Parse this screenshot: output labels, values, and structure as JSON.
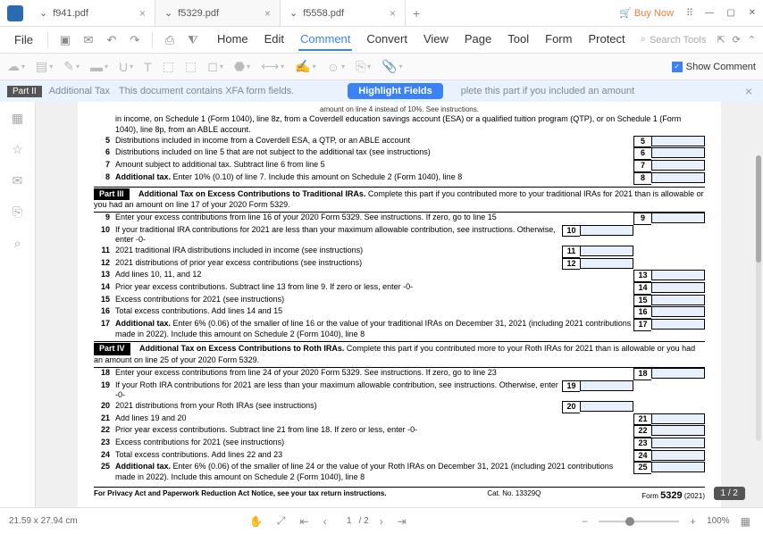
{
  "titlebar": {
    "tabs": [
      {
        "name": "f941.pdf",
        "active": false
      },
      {
        "name": "f5329.pdf",
        "active": true
      },
      {
        "name": "f5558.pdf",
        "active": false
      }
    ],
    "buynow": "Buy Now"
  },
  "menubar": {
    "file": "File",
    "nav": {
      "home": "Home",
      "edit": "Edit",
      "comment": "Comment",
      "convert": "Convert",
      "view": "View",
      "page": "Page",
      "tool": "Tool",
      "form": "Form",
      "protect": "Protect"
    },
    "search_placeholder": "Search Tools"
  },
  "toolbar": {
    "showcomment": "Show Comment"
  },
  "notice": {
    "part": "Part II",
    "title_fragment": "Additional Tax",
    "msg": "This document contains XFA form fields.",
    "button": "Highlight Fields",
    "tail": "plete this part if you included an amount"
  },
  "doc": {
    "pre_text": "amount on line 4 instead of 10%. See instructions.",
    "line_a": "in income, on Schedule 1 (Form 1040), line 8z, from a Coverdell education savings account (ESA) or a qualified tuition program (QTP), or on Schedule 1 (Form 1040), line 8p, from an ABLE account.",
    "rows_a": [
      {
        "n": "5",
        "t": "Distributions included in income from a Coverdell ESA, a QTP, or an ABLE account",
        "box": "5"
      },
      {
        "n": "6",
        "t": "Distributions included on line 5 that are not subject to the additional tax (see instructions)",
        "box": "6"
      },
      {
        "n": "7",
        "t": "Amount subject to additional tax. Subtract line 6 from line 5",
        "box": "7"
      },
      {
        "n": "8",
        "t": "Additional tax. Enter 10% (0.10) of line 7. Include this amount on Schedule 2 (Form 1040), line 8",
        "box": "8",
        "bold_lead": "Additional tax."
      }
    ],
    "part3": {
      "label": "Part III",
      "title": "Additional Tax on Excess Contributions to Traditional IRAs.",
      "desc": "Complete this part if you contributed more to your traditional IRAs for 2021 than is allowable or you had an amount on line 17 of your 2020 Form 5329."
    },
    "rows_b": [
      {
        "n": "9",
        "t": "Enter your excess contributions from line 16 of your 2020 Form 5329. See instructions. If zero, go to line 15",
        "box": "9",
        "right": true
      },
      {
        "n": "10",
        "t": "If your traditional IRA contributions for 2021 are less than your maximum allowable contribution, see instructions. Otherwise, enter -0-",
        "box": "10",
        "inner": true
      },
      {
        "n": "11",
        "t": "2021 traditional IRA distributions included in income (see instructions)",
        "box": "11",
        "inner": true
      },
      {
        "n": "12",
        "t": "2021 distributions of prior year excess contributions (see instructions)",
        "box": "12",
        "inner": true
      },
      {
        "n": "13",
        "t": "Add lines 10, 11, and 12",
        "box": "13",
        "right": true
      },
      {
        "n": "14",
        "t": "Prior year excess contributions. Subtract line 13 from line 9. If zero or less, enter -0-",
        "box": "14",
        "right": true
      },
      {
        "n": "15",
        "t": "Excess contributions for 2021 (see instructions)",
        "box": "15",
        "right": true
      },
      {
        "n": "16",
        "t": "Total excess contributions. Add lines 14 and 15",
        "box": "16",
        "right": true
      },
      {
        "n": "17",
        "t": "Additional tax. Enter 6% (0.06) of the smaller of line 16 or the value of your traditional IRAs on December 31, 2021 (including 2021 contributions made in 2022). Include this amount on Schedule 2 (Form 1040), line 8",
        "box": "17",
        "right": true,
        "bold_lead": "Additional tax."
      }
    ],
    "part4": {
      "label": "Part IV",
      "title": "Additional Tax on Excess Contributions to Roth IRAs.",
      "desc": "Complete this part if you contributed more to your Roth IRAs for 2021 than is allowable or you had an amount on line 25 of your 2020 Form 5329."
    },
    "rows_c": [
      {
        "n": "18",
        "t": "Enter your excess contributions from line 24 of your 2020 Form 5329. See instructions. If zero, go to line 23",
        "box": "18",
        "right": true
      },
      {
        "n": "19",
        "t": "If your Roth IRA contributions for 2021 are less than your maximum allowable contribution, see instructions. Otherwise, enter -0-",
        "box": "19",
        "inner": true
      },
      {
        "n": "20",
        "t": "2021 distributions from your Roth IRAs (see instructions)",
        "box": "20",
        "inner": true
      },
      {
        "n": "21",
        "t": "Add lines 19 and 20",
        "box": "21",
        "right": true
      },
      {
        "n": "22",
        "t": "Prior year excess contributions. Subtract line 21 from line 18. If zero or less, enter -0-",
        "box": "22",
        "right": true
      },
      {
        "n": "23",
        "t": "Excess contributions for 2021 (see instructions)",
        "box": "23",
        "right": true
      },
      {
        "n": "24",
        "t": "Total excess contributions. Add lines 22 and 23",
        "box": "24",
        "right": true
      },
      {
        "n": "25",
        "t": "Additional tax. Enter 6% (0.06) of the smaller of line 24 or the value of your Roth IRAs on December 31, 2021 (including 2021 contributions made in 2022). Include this amount on Schedule 2 (Form 1040), line 8",
        "box": "25",
        "right": true,
        "bold_lead": "Additional tax."
      }
    ],
    "footer": {
      "privacy": "For Privacy Act and Paperwork Reduction Act Notice, see your tax return instructions.",
      "cat": "Cat. No. 13329Q",
      "form": "Form",
      "formno": "5329",
      "year": "(2021)"
    },
    "pagebadge": "1 / 2"
  },
  "statusbar": {
    "dims": "21.59 x 27.94 cm",
    "page": "1",
    "total": "/ 2",
    "zoom": "100%"
  }
}
